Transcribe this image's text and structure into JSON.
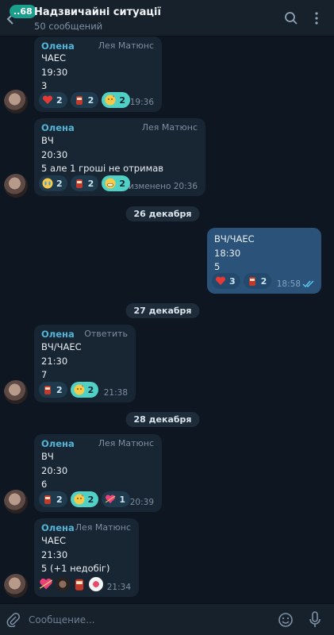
{
  "header": {
    "badge": "..68",
    "title": "Надзвичайні ситуації",
    "subtitle": "50 сообщений"
  },
  "messages": [
    {
      "sender": "Олена",
      "author": "Лея Матюнс",
      "lines": [
        "ЧАЕС",
        "19:30",
        "3"
      ],
      "time": "19:36",
      "reactions": [
        {
          "emoji": "heart",
          "count": "2"
        },
        {
          "emoji": "cup",
          "count": "2"
        },
        {
          "emoji": "kiss",
          "count": "2"
        }
      ]
    },
    {
      "sender": "Олена",
      "author": "Лея Матюнс",
      "lines": [
        "ВЧ",
        "20:30",
        "5 але 1 гроші не отримав"
      ],
      "time": "изменено 20:36",
      "reactions": [
        {
          "emoji": "cry",
          "count": "2"
        },
        {
          "emoji": "cup",
          "count": "2"
        },
        {
          "emoji": "grin",
          "count": "2"
        }
      ]
    },
    {
      "date": "26 декабря"
    },
    {
      "outgoing": true,
      "lines": [
        "ВЧ/ЧАЕС",
        "18:30",
        "5"
      ],
      "time": "18:58",
      "reactions": [
        {
          "emoji": "heart",
          "count": "3"
        },
        {
          "emoji": "cup",
          "count": "2"
        }
      ]
    },
    {
      "date": "27 декабря"
    },
    {
      "sender": "Олена",
      "author": "Ответить",
      "lines": [
        "ВЧ/ЧАЕС",
        "21:30",
        "7"
      ],
      "time": "21:38",
      "reactions": [
        {
          "emoji": "cup",
          "count": "2"
        },
        {
          "emoji": "kiss",
          "count": "2"
        }
      ]
    },
    {
      "date": "28 декабря"
    },
    {
      "sender": "Олена",
      "author": "Лея Матюнс",
      "lines": [
        "ВЧ",
        "20:30",
        "6"
      ],
      "time": "20:39",
      "reactions": [
        {
          "emoji": "cup",
          "count": "2"
        },
        {
          "emoji": "kiss",
          "count": "2"
        },
        {
          "emoji": "heart-broken",
          "count": "1"
        }
      ]
    },
    {
      "sender": "Олена",
      "author": "Лея Матюнс",
      "lines": [
        "ЧАЕС",
        "21:30",
        "5 (+1 недобіг)"
      ],
      "time": "21:34",
      "reactions": [
        {
          "emoji": "heart-broken",
          "count": ""
        },
        {
          "emoji": "avatar",
          "count": ""
        },
        {
          "emoji": "cup",
          "count": ""
        },
        {
          "emoji": "avatar2",
          "count": ""
        }
      ]
    }
  ],
  "composer": {
    "placeholder": "Сообщение..."
  },
  "colors": {
    "background": "#0e1621",
    "bubble_in": "#182533",
    "bubble_out": "#2b5278",
    "sender": "#52b5d8",
    "reaction_mine": "#4fd1c5",
    "badge": "#1b9e8c"
  }
}
